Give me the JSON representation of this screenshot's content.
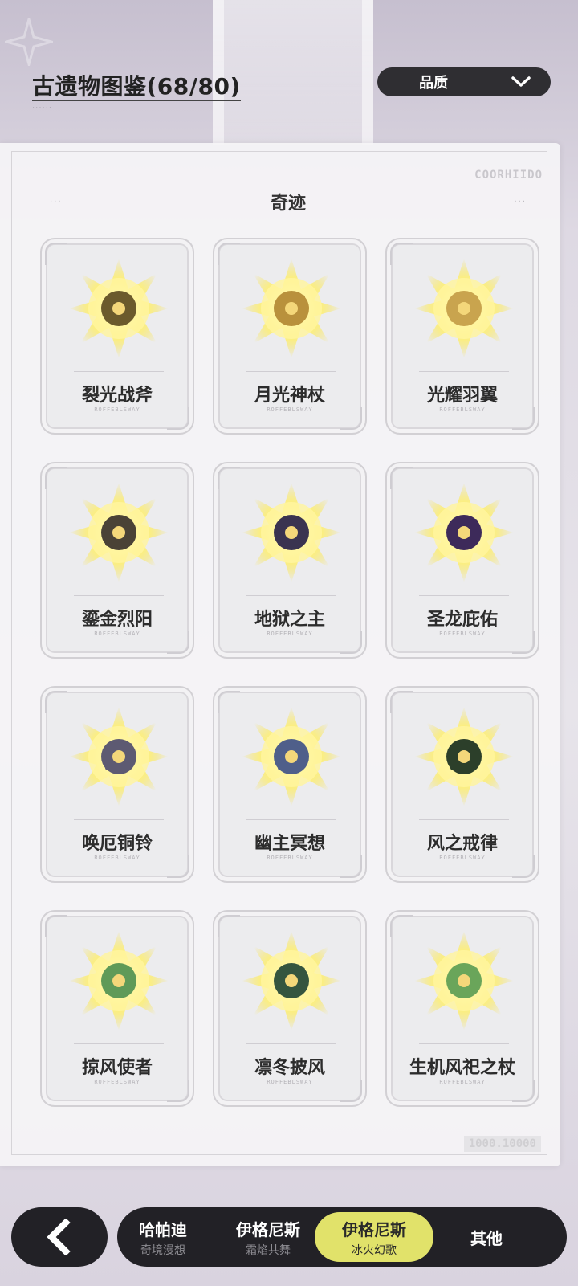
{
  "header": {
    "title": "古遗物图鉴(68/80)",
    "title_dots": "......",
    "filter_label": "品质"
  },
  "panel": {
    "code_top": "COORHIIDO",
    "code_bottom": "1000.10000",
    "section_title": "奇迹"
  },
  "items": [
    {
      "name": "裂光战斧",
      "sub": "ROFFEBLSWAY",
      "icon": "axe-icon",
      "color": "#6b5a2c"
    },
    {
      "name": "月光神杖",
      "sub": "ROFFEBLSWAY",
      "icon": "moon-scepter-icon",
      "color": "#b9913c"
    },
    {
      "name": "光耀羽翼",
      "sub": "ROFFEBLSWAY",
      "icon": "wing-icon",
      "color": "#c9a44e"
    },
    {
      "name": "鎏金烈阳",
      "sub": "ROFFEBLSWAY",
      "icon": "sun-spear-icon",
      "color": "#4a4236"
    },
    {
      "name": "地狱之主",
      "sub": "ROFFEBLSWAY",
      "icon": "throne-icon",
      "color": "#3a3350"
    },
    {
      "name": "圣龙庇佑",
      "sub": "ROFFEBLSWAY",
      "icon": "dragon-icon",
      "color": "#3d2a5a"
    },
    {
      "name": "唤厄铜铃",
      "sub": "ROFFEBLSWAY",
      "icon": "bell-icon",
      "color": "#5d5a72"
    },
    {
      "name": "幽主冥想",
      "sub": "ROFFEBLSWAY",
      "icon": "staff-icon",
      "color": "#4f5f8a"
    },
    {
      "name": "风之戒律",
      "sub": "ROFFEBLSWAY",
      "icon": "orb-icon",
      "color": "#2c3f2a"
    },
    {
      "name": "掠风使者",
      "sub": "ROFFEBLSWAY",
      "icon": "dragonfly-icon",
      "color": "#5f9a58"
    },
    {
      "name": "凛冬披风",
      "sub": "ROFFEBLSWAY",
      "icon": "cloak-icon",
      "color": "#35553f"
    },
    {
      "name": "生机风祀之杖",
      "sub": "ROFFEBLSWAY",
      "icon": "leaf-staff-icon",
      "color": "#6aa55a"
    }
  ],
  "tabs": [
    {
      "title": "哈帕迪",
      "sub": "奇境漫想",
      "active": false
    },
    {
      "title": "伊格尼斯",
      "sub": "霜焰共舞",
      "active": false
    },
    {
      "title": "伊格尼斯",
      "sub": "冰火幻歌",
      "active": true
    },
    {
      "title": "其他",
      "sub": "",
      "active": false
    }
  ],
  "colors": {
    "accent": "#e1e26a",
    "dark": "#222126",
    "glow": "#fff176"
  }
}
